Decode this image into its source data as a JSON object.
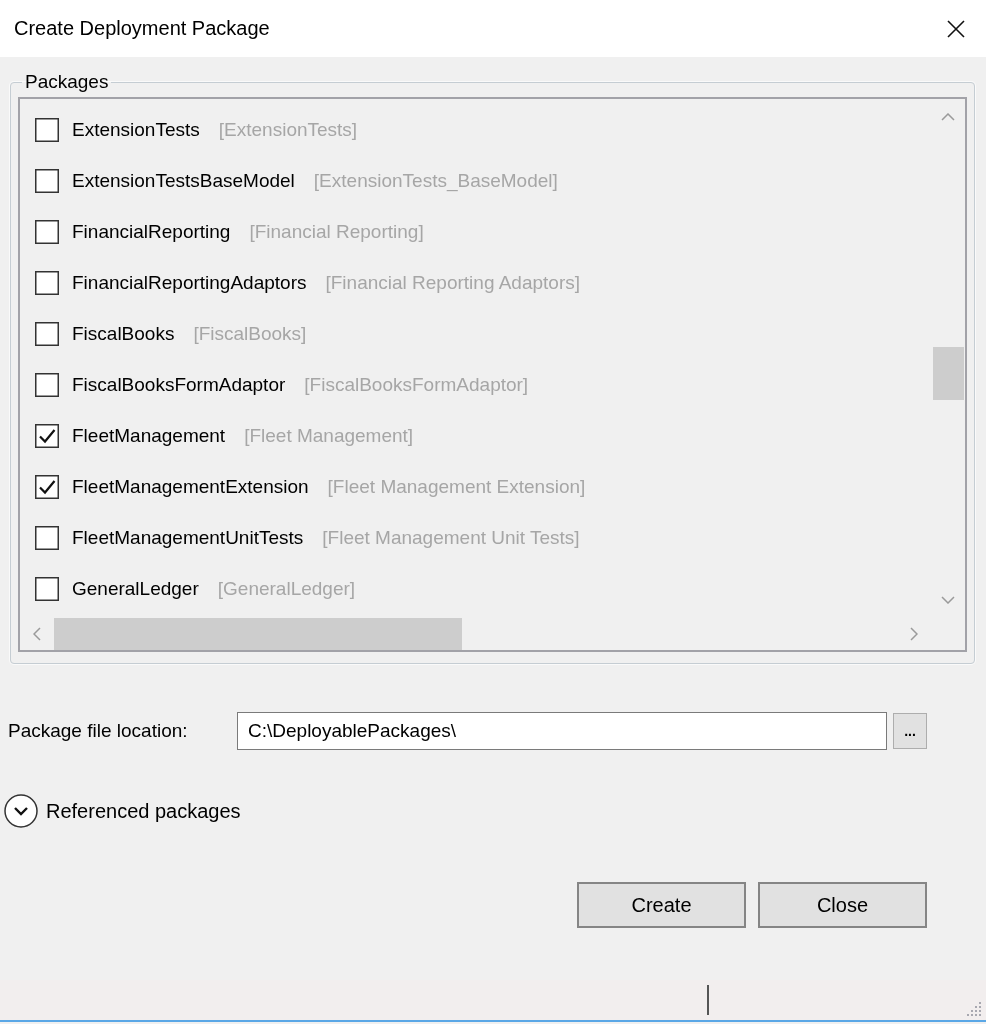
{
  "window": {
    "title": "Create Deployment Package"
  },
  "packages": {
    "legend": "Packages",
    "items": [
      {
        "name": "ExtensionTests",
        "display_name": "[ExtensionTests]",
        "checked": false
      },
      {
        "name": "ExtensionTestsBaseModel",
        "display_name": "[ExtensionTests_BaseModel]",
        "checked": false
      },
      {
        "name": "FinancialReporting",
        "display_name": "[Financial Reporting]",
        "checked": false
      },
      {
        "name": "FinancialReportingAdaptors",
        "display_name": "[Financial Reporting Adaptors]",
        "checked": false
      },
      {
        "name": "FiscalBooks",
        "display_name": "[FiscalBooks]",
        "checked": false
      },
      {
        "name": "FiscalBooksFormAdaptor",
        "display_name": "[FiscalBooksFormAdaptor]",
        "checked": false
      },
      {
        "name": "FleetManagement",
        "display_name": "[Fleet Management]",
        "checked": true
      },
      {
        "name": "FleetManagementExtension",
        "display_name": "[Fleet Management Extension]",
        "checked": true
      },
      {
        "name": "FleetManagementUnitTests",
        "display_name": "[Fleet Management Unit Tests]",
        "checked": false
      },
      {
        "name": "GeneralLedger",
        "display_name": "[GeneralLedger]",
        "checked": false
      }
    ]
  },
  "file_location": {
    "label": "Package file location:",
    "value": "C:\\DeployablePackages\\",
    "browse_button": "..."
  },
  "referenced_packages": {
    "label": "Referenced packages",
    "expanded": false
  },
  "buttons": [
    "Create",
    "Close"
  ]
}
